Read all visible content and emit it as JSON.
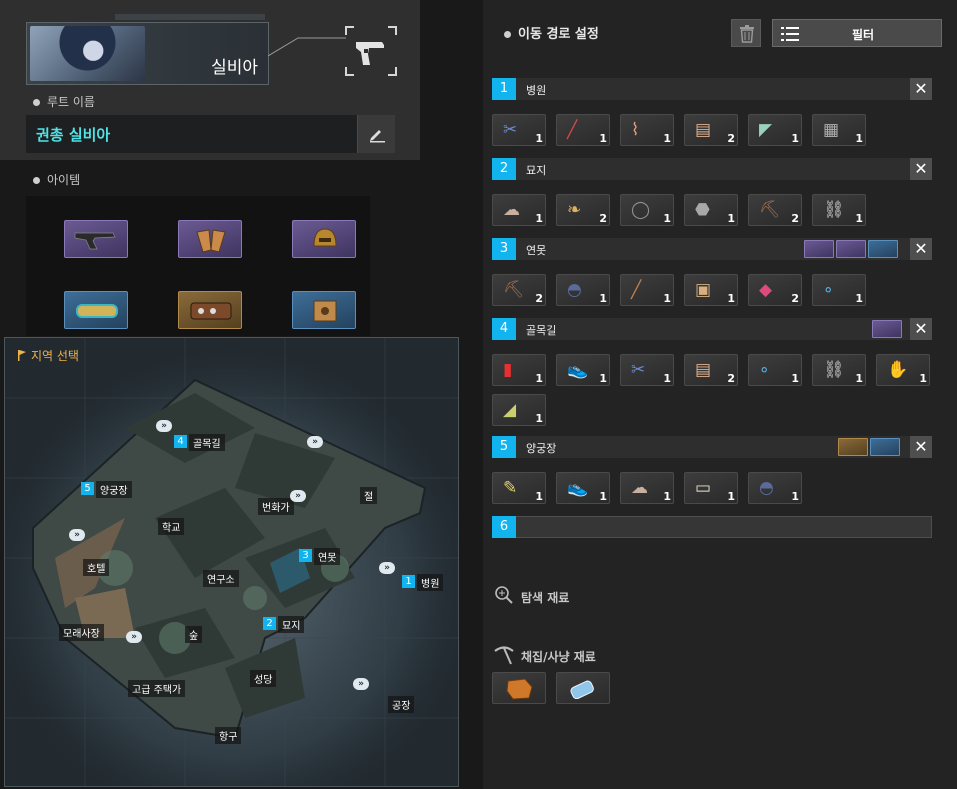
{
  "character": {
    "name": "실비아",
    "weapon_icon": "pistol-icon"
  },
  "route_name": {
    "label": "루트 이름",
    "value": "권총 실비아"
  },
  "items": {
    "label": "아이템",
    "slots": [
      {
        "icon": "revolver-icon",
        "grade": "purple"
      },
      {
        "icon": "glove-icon",
        "grade": "purple"
      },
      {
        "icon": "helmet-icon",
        "grade": "purple"
      },
      {
        "icon": "bracelet-icon",
        "grade": "blue"
      },
      {
        "icon": "bracer-icon",
        "grade": "gold"
      },
      {
        "icon": "box-icon",
        "grade": "blue"
      }
    ]
  },
  "map": {
    "title": "지역 선택",
    "places": [
      {
        "name": "골목길",
        "num": "4"
      },
      {
        "name": "양궁장",
        "num": "5"
      },
      {
        "name": "번화가",
        "num": ""
      },
      {
        "name": "절",
        "num": ""
      },
      {
        "name": "학교",
        "num": ""
      },
      {
        "name": "호텔",
        "num": ""
      },
      {
        "name": "연구소",
        "num": ""
      },
      {
        "name": "연못",
        "num": "3"
      },
      {
        "name": "병원",
        "num": "1"
      },
      {
        "name": "모래사장",
        "num": ""
      },
      {
        "name": "숲",
        "num": ""
      },
      {
        "name": "묘지",
        "num": "2"
      },
      {
        "name": "고급 주택가",
        "num": ""
      },
      {
        "name": "성당",
        "num": ""
      },
      {
        "name": "공장",
        "num": ""
      },
      {
        "name": "항구",
        "num": ""
      }
    ]
  },
  "path_panel": {
    "title": "이동 경로 설정",
    "trash_icon": "trash-icon",
    "filter_label": "필터"
  },
  "routes": [
    {
      "num": "1",
      "name": "병원",
      "items": [
        {
          "icon": "scissors-icon",
          "count": "1"
        },
        {
          "icon": "needle-icon",
          "count": "1"
        },
        {
          "icon": "branch-icon",
          "count": "1"
        },
        {
          "icon": "bandage-icon",
          "count": "2"
        },
        {
          "icon": "scalpel-icon",
          "count": "1"
        },
        {
          "icon": "scrap-icon",
          "count": "1"
        }
      ]
    },
    {
      "num": "2",
      "name": "묘지",
      "items": [
        {
          "icon": "cloth-icon",
          "count": "1"
        },
        {
          "icon": "feather-icon",
          "count": "2"
        },
        {
          "icon": "wire-icon",
          "count": "1"
        },
        {
          "icon": "stone-icon",
          "count": "1"
        },
        {
          "icon": "pickaxe-icon",
          "count": "2"
        },
        {
          "icon": "chain-icon",
          "count": "1"
        }
      ]
    },
    {
      "num": "3",
      "name": "연못",
      "items": [
        {
          "icon": "pickaxe-icon",
          "count": "2"
        },
        {
          "icon": "cap-icon",
          "count": "1"
        },
        {
          "icon": "stick-icon",
          "count": "1"
        },
        {
          "icon": "cardboard-icon",
          "count": "1"
        },
        {
          "icon": "ruby-icon",
          "count": "2"
        },
        {
          "icon": "beads-icon",
          "count": "1"
        }
      ]
    },
    {
      "num": "4",
      "name": "골목길",
      "items": [
        {
          "icon": "lighter-icon",
          "count": "1"
        },
        {
          "icon": "sneakers-icon",
          "count": "1"
        },
        {
          "icon": "scissors-icon",
          "count": "1"
        },
        {
          "icon": "bandage-icon",
          "count": "2"
        },
        {
          "icon": "beads-icon",
          "count": "1"
        },
        {
          "icon": "chain-icon",
          "count": "1"
        },
        {
          "icon": "glove-dark-icon",
          "count": "1"
        },
        {
          "icon": "glue-icon",
          "count": "1"
        }
      ]
    },
    {
      "num": "5",
      "name": "양궁장",
      "items": [
        {
          "icon": "feather-pen-icon",
          "count": "1"
        },
        {
          "icon": "sneakers-icon",
          "count": "1"
        },
        {
          "icon": "cloth-icon",
          "count": "1"
        },
        {
          "icon": "paper-icon",
          "count": "1"
        },
        {
          "icon": "cap-icon",
          "count": "1"
        }
      ]
    },
    {
      "num": "6",
      "name": "",
      "items": []
    }
  ],
  "search_materials": {
    "title": "탐색 재료"
  },
  "gather_materials": {
    "title": "채집/사냥 재료",
    "items": [
      {
        "icon": "leather-icon"
      },
      {
        "icon": "water-bottle-icon"
      }
    ]
  }
}
